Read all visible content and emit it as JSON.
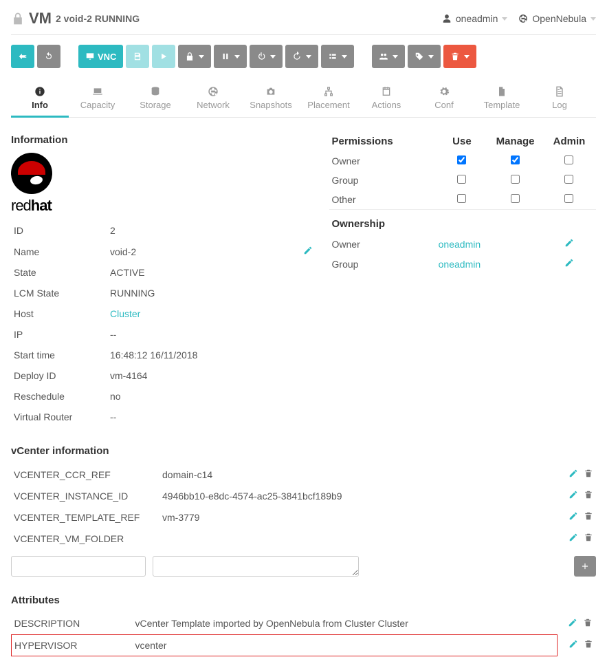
{
  "header": {
    "title": "VM",
    "subtitle": "2 void-2 RUNNING",
    "user": "oneadmin",
    "zone": "OpenNebula"
  },
  "toolbar": {
    "vnc_label": "VNC"
  },
  "tabs": [
    {
      "key": "info",
      "label": "Info"
    },
    {
      "key": "capacity",
      "label": "Capacity"
    },
    {
      "key": "storage",
      "label": "Storage"
    },
    {
      "key": "network",
      "label": "Network"
    },
    {
      "key": "snapshots",
      "label": "Snapshots"
    },
    {
      "key": "placement",
      "label": "Placement"
    },
    {
      "key": "actions",
      "label": "Actions"
    },
    {
      "key": "conf",
      "label": "Conf"
    },
    {
      "key": "template",
      "label": "Template"
    },
    {
      "key": "log",
      "label": "Log"
    }
  ],
  "info": {
    "heading": "Information",
    "logo_text_1": "red",
    "logo_text_2": "hat",
    "rows": {
      "id": {
        "label": "ID",
        "value": "2"
      },
      "name": {
        "label": "Name",
        "value": "void-2"
      },
      "state": {
        "label": "State",
        "value": "ACTIVE"
      },
      "lcm": {
        "label": "LCM State",
        "value": "RUNNING"
      },
      "host": {
        "label": "Host",
        "value": "Cluster"
      },
      "ip": {
        "label": "IP",
        "value": "--"
      },
      "start": {
        "label": "Start time",
        "value": "16:48:12 16/11/2018"
      },
      "deploy": {
        "label": "Deploy ID",
        "value": "vm-4164"
      },
      "resched": {
        "label": "Reschedule",
        "value": "no"
      },
      "vrouter": {
        "label": "Virtual Router",
        "value": "--"
      }
    }
  },
  "perm": {
    "heading": "Permissions",
    "cols": {
      "use": "Use",
      "manage": "Manage",
      "admin": "Admin"
    },
    "rows": [
      {
        "label": "Owner",
        "use": true,
        "manage": true,
        "admin": false
      },
      {
        "label": "Group",
        "use": false,
        "manage": false,
        "admin": false
      },
      {
        "label": "Other",
        "use": false,
        "manage": false,
        "admin": false
      }
    ],
    "ownership_heading": "Ownership",
    "ownership": [
      {
        "label": "Owner",
        "value": "oneadmin"
      },
      {
        "label": "Group",
        "value": "oneadmin"
      }
    ]
  },
  "vcenter": {
    "heading": "vCenter information",
    "rows": [
      {
        "key": "VCENTER_CCR_REF",
        "value": "domain-c14"
      },
      {
        "key": "VCENTER_INSTANCE_ID",
        "value": "4946bb10-e8dc-4574-ac25-3841bcf189b9"
      },
      {
        "key": "VCENTER_TEMPLATE_REF",
        "value": "vm-3779"
      },
      {
        "key": "VCENTER_VM_FOLDER",
        "value": ""
      }
    ]
  },
  "attributes": {
    "heading": "Attributes",
    "rows": [
      {
        "key": "DESCRIPTION",
        "value": "vCenter Template imported by OpenNebula from Cluster Cluster",
        "highlight": false
      },
      {
        "key": "HYPERVISOR",
        "value": "vcenter",
        "highlight": true
      }
    ]
  }
}
